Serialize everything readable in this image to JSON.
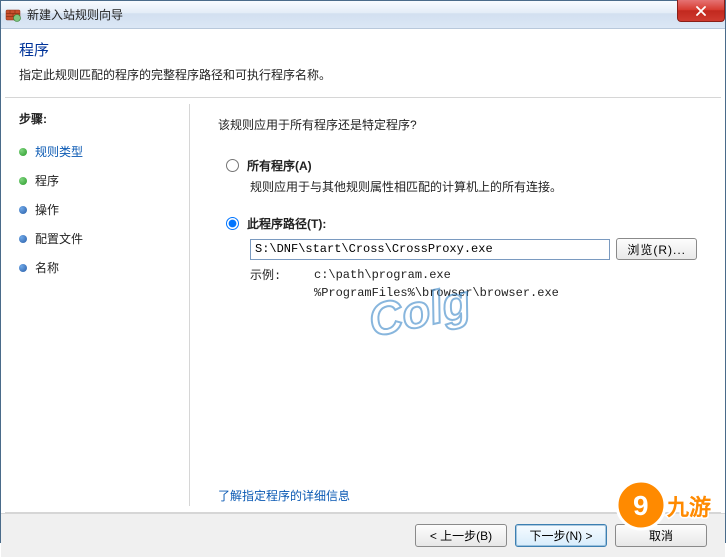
{
  "window": {
    "title": "新建入站规则向导",
    "close_aria": "关闭"
  },
  "header": {
    "title": "程序",
    "desc": "指定此规则匹配的程序的完整程序路径和可执行程序名称。"
  },
  "sidebar": {
    "heading": "步骤:",
    "steps": [
      {
        "label": "规则类型",
        "state": "past"
      },
      {
        "label": "程序",
        "state": "current"
      },
      {
        "label": "操作",
        "state": "future"
      },
      {
        "label": "配置文件",
        "state": "future"
      },
      {
        "label": "名称",
        "state": "future"
      }
    ]
  },
  "content": {
    "question": "该规则应用于所有程序还是特定程序?",
    "option_all": {
      "label": "所有程序(A)",
      "desc": "规则应用于与其他规则属性相匹配的计算机上的所有连接。",
      "checked": false
    },
    "option_path": {
      "label": "此程序路径(T):",
      "checked": true,
      "value": "S:\\DNF\\start\\Cross\\CrossProxy.exe",
      "browse_label": "浏览(R)...",
      "example_label": "示例:",
      "example_paths": "c:\\path\\program.exe\n%ProgramFiles%\\browser\\browser.exe"
    },
    "learn_more": "了解指定程序的详细信息"
  },
  "footer": {
    "back": "< 上一步(B)",
    "next": "下一步(N) >",
    "cancel": "取消"
  },
  "watermark": {
    "center": "Colg",
    "corner": "9 九游"
  }
}
